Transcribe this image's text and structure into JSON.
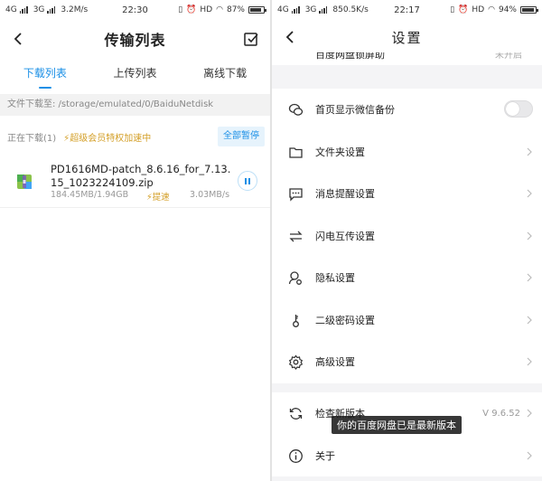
{
  "left": {
    "status": {
      "network": "4G",
      "network2": "3G",
      "speed": "3.2M/s",
      "time": "22:30",
      "hd": "HD",
      "battery": "87%",
      "battery_level": 0.87
    },
    "header": {
      "title": "传输列表"
    },
    "tabs": [
      {
        "label": "下载列表",
        "active": true
      },
      {
        "label": "上传列表",
        "active": false
      },
      {
        "label": "离线下载",
        "active": false
      }
    ],
    "path_label": "文件下载至: /storage/emulated/0/BaiduNetdisk",
    "section": {
      "count": "正在下载(1)",
      "vip": "⚡超级会员特权加速中",
      "pause_all": "全部暂停"
    },
    "download": {
      "name": "PD1616MD-patch_8.6.16_for_7.13.15_1023224109.zip",
      "size": "184.45MB/1.94GB",
      "boost": "⚡提速",
      "speed": "3.03MB/s"
    }
  },
  "right": {
    "status": {
      "network": "4G",
      "network2": "3G",
      "speed": "850.5K/s",
      "time": "22:17",
      "hd": "HD",
      "battery": "94%",
      "battery_level": 0.94
    },
    "header": {
      "title": "设置"
    },
    "partial": {
      "label": "百度网盘锁屏助",
      "value": "未开启"
    },
    "rows": [
      {
        "label": "首页显示微信备份",
        "icon": "wechat-icon"
      },
      {
        "label": "文件夹设置",
        "icon": "folder-icon"
      },
      {
        "label": "消息提醒设置",
        "icon": "message-icon"
      },
      {
        "label": "闪电互传设置",
        "icon": "transfer-icon"
      },
      {
        "label": "隐私设置",
        "icon": "privacy-icon"
      },
      {
        "label": "二级密码设置",
        "icon": "key-icon"
      },
      {
        "label": "高级设置",
        "icon": "gear-icon"
      }
    ],
    "update": {
      "label": "检查新版本",
      "version": "V 9.6.52",
      "icon": "refresh-icon"
    },
    "about": {
      "label": "关于",
      "icon": "info-icon"
    },
    "toast": "你的百度网盘已是最新版本"
  }
}
